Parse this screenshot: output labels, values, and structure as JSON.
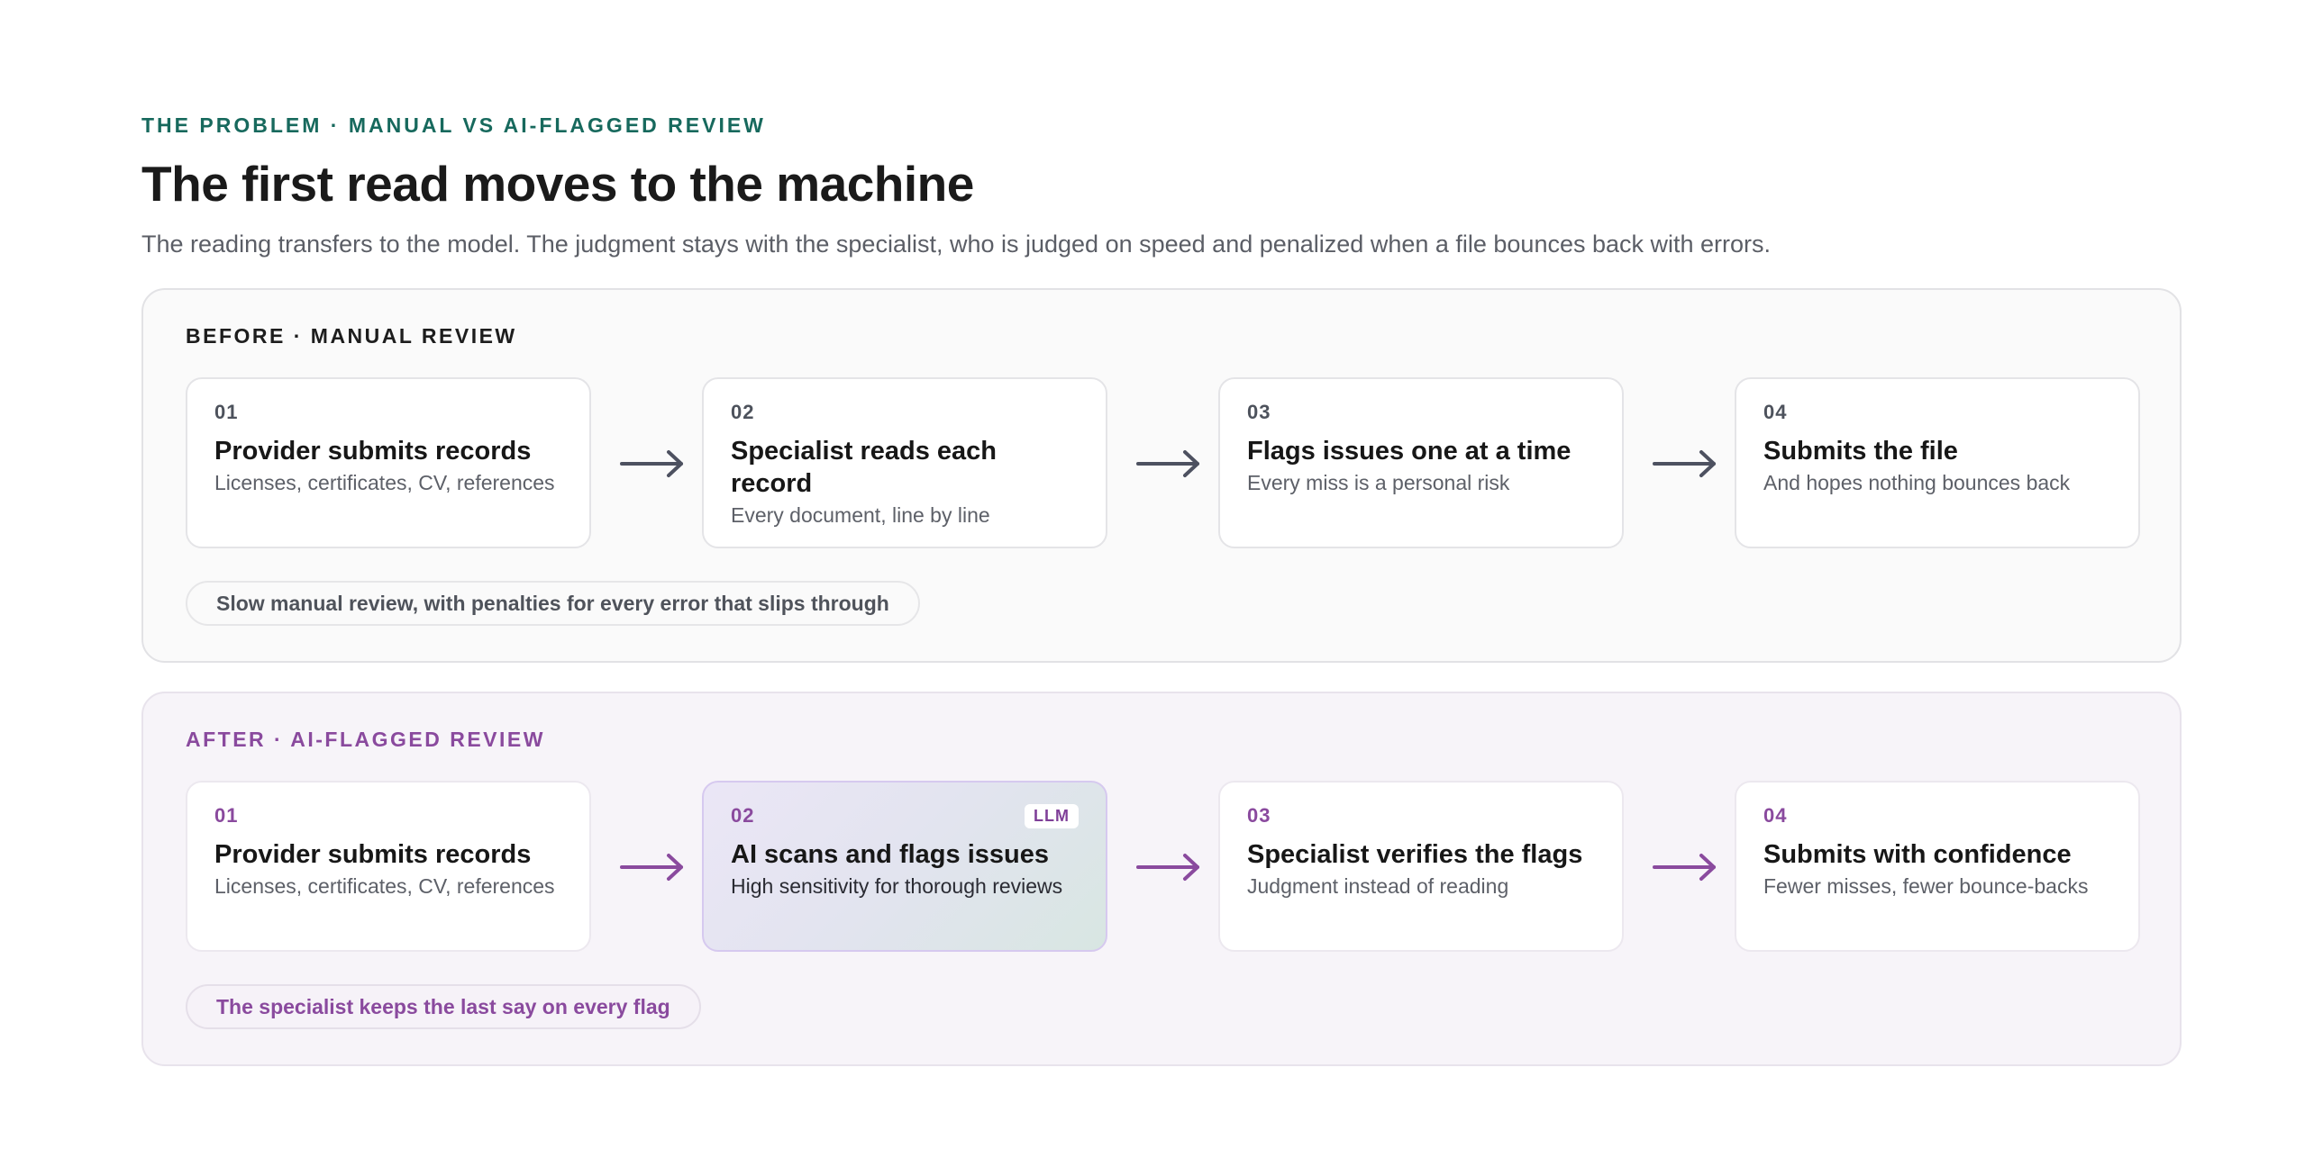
{
  "header": {
    "eyebrow": "THE PROBLEM · MANUAL VS AI-FLAGGED REVIEW",
    "title": "The first read moves to the machine",
    "subtitle": "The reading transfers to the model. The judgment stays with the specialist, who is judged on speed and penalized when a file bounces back with errors."
  },
  "before": {
    "label": "BEFORE · MANUAL REVIEW",
    "steps": [
      {
        "num": "01",
        "title": "Provider submits records",
        "desc": "Licenses, certificates, CV, references"
      },
      {
        "num": "02",
        "title": "Specialist reads each record",
        "desc": "Every document, line by line"
      },
      {
        "num": "03",
        "title": "Flags issues one at a time",
        "desc": "Every miss is a personal risk"
      },
      {
        "num": "04",
        "title": "Submits the file",
        "desc": "And hopes nothing bounces back"
      }
    ],
    "note": "Slow manual review, with penalties for every error that slips through",
    "arrow_color": "#4d5160"
  },
  "after": {
    "label": "AFTER · AI-FLAGGED REVIEW",
    "steps": [
      {
        "num": "01",
        "title": "Provider submits records",
        "desc": "Licenses, certificates, CV, references"
      },
      {
        "num": "02",
        "title": "AI scans and flags issues",
        "desc": "High sensitivity for thorough reviews",
        "badge": "LLM"
      },
      {
        "num": "03",
        "title": "Specialist verifies the flags",
        "desc": "Judgment instead of reading"
      },
      {
        "num": "04",
        "title": "Submits with confidence",
        "desc": "Fewer misses, fewer bounce-backs"
      }
    ],
    "note": "The specialist keeps the last say on every flag",
    "arrow_color": "#8a4a9e"
  },
  "colors": {
    "accent_teal": "#17695d",
    "accent_purple": "#8a4a9e"
  },
  "icons": {
    "arrow": "arrow-right-icon"
  }
}
